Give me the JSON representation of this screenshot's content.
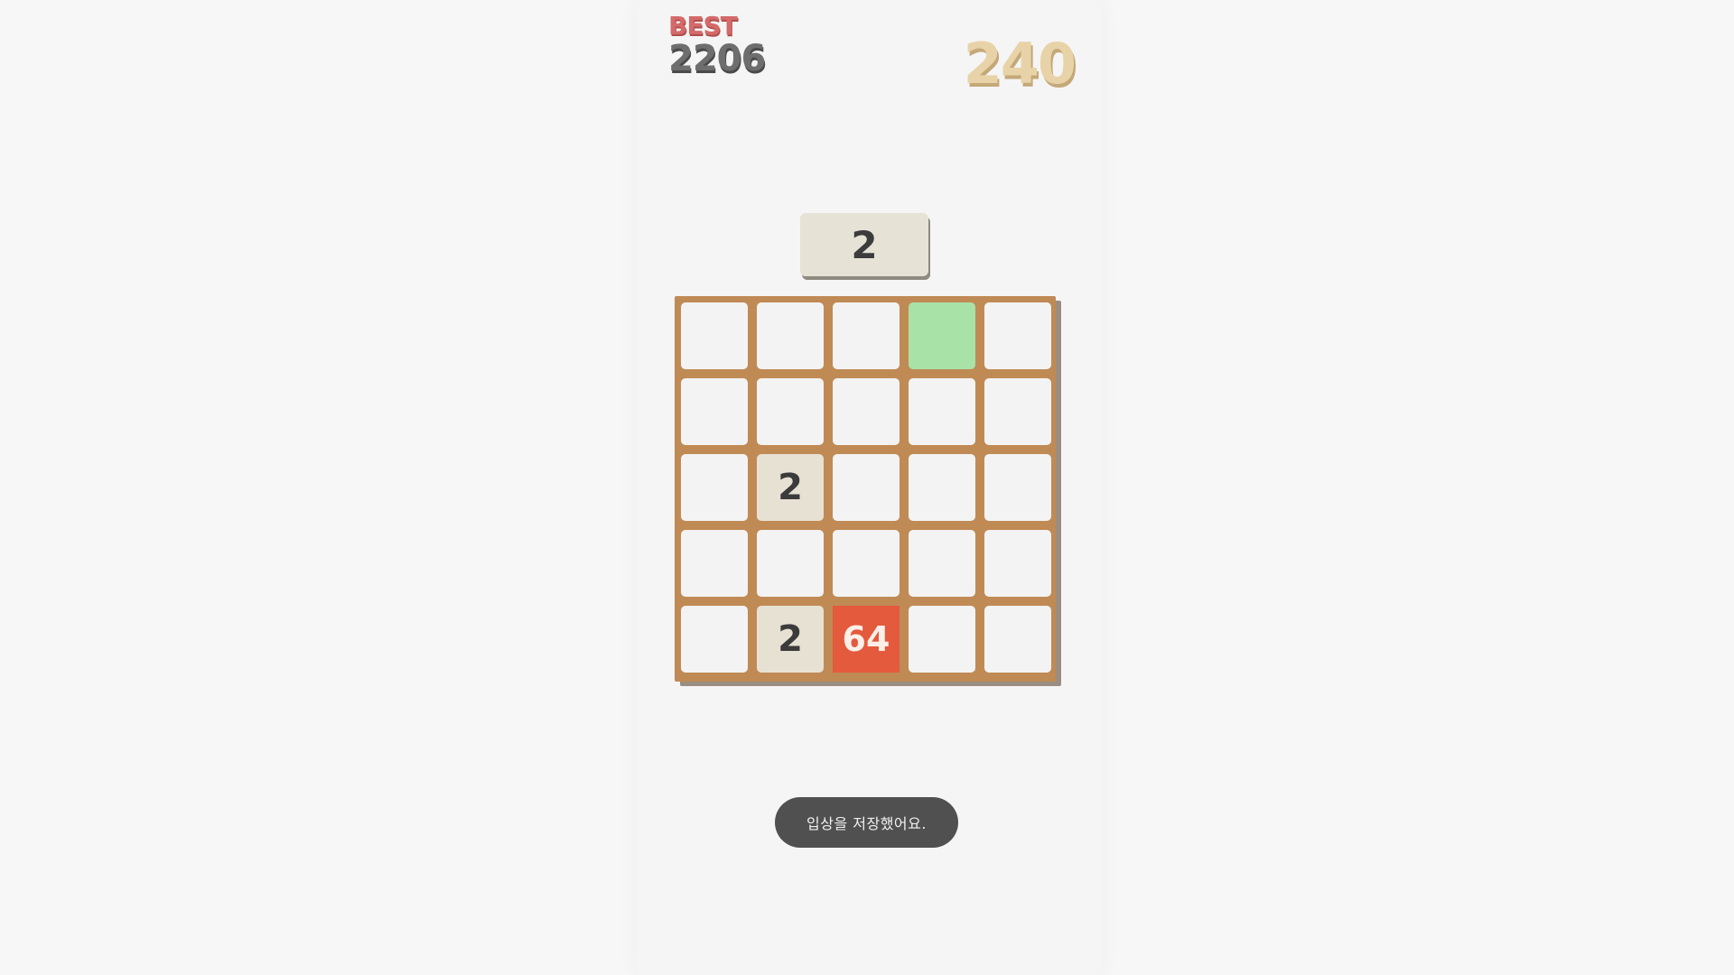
{
  "header": {
    "best_label": "BEST",
    "best_score": "2206",
    "current_score": "240"
  },
  "next_tile": {
    "value": "2"
  },
  "board": {
    "rows": 5,
    "cols": 5,
    "cells": [
      [
        "",
        "",
        "",
        "",
        ""
      ],
      [
        "",
        "",
        "",
        "",
        ""
      ],
      [
        "",
        "2",
        "",
        "",
        ""
      ],
      [
        "",
        "",
        "",
        "",
        ""
      ],
      [
        "",
        "2",
        "64",
        "",
        ""
      ]
    ],
    "highlight": {
      "row": 0,
      "col": 3
    }
  },
  "toast": {
    "message": "입상을 저장했어요."
  },
  "colors": {
    "board_frame": "#c08a55",
    "empty_cell": "#f3f3f3",
    "highlight_cell": "#a9e2a6",
    "tile_2": "#e7e1d3",
    "tile_64": "#e45a3c",
    "best_label": "#d46a6a",
    "score": "#e8d3a8"
  }
}
